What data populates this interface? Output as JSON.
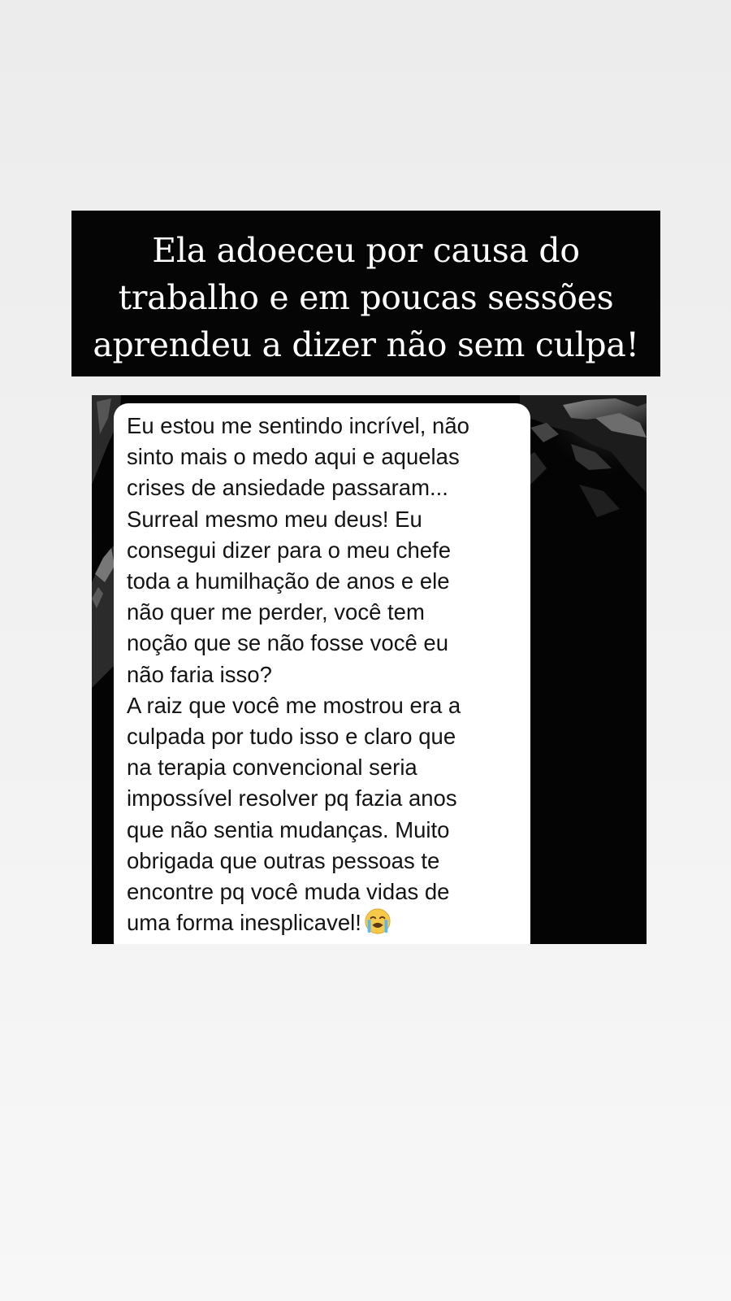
{
  "post": {
    "headline_lines": [
      "Ela adoeceu por causa do",
      "trabalho e em poucas sessões",
      "aprendeu a dizer não sem culpa!"
    ],
    "message_lines": [
      "Eu estou me sentindo incrível, não",
      "sinto mais o medo aqui e aquelas",
      "crises de ansiedade passaram...",
      "Surreal mesmo meu deus! Eu",
      "consegui dizer para o meu chefe",
      "toda a humilhação de anos e ele",
      "não quer me perder, você tem",
      "noção que se não fosse você eu",
      "não faria isso?",
      "A raiz que você me mostrou era a",
      "culpada por tudo isso e claro que",
      "na terapia convencional seria",
      "impossível resolver pq fazia anos",
      "que não sentia mudanças. Muito",
      "obrigada que outras pessoas te",
      "encontre pq você muda vidas de",
      "uma forma inesplicavel!"
    ],
    "message_end_emoji": "loudly-crying-face-emoji"
  },
  "colors": {
    "page_background": "#efefef",
    "headline_background": "#050505",
    "headline_text": "#ffffff",
    "bubble_background": "#ffffff",
    "message_text": "#141414"
  }
}
